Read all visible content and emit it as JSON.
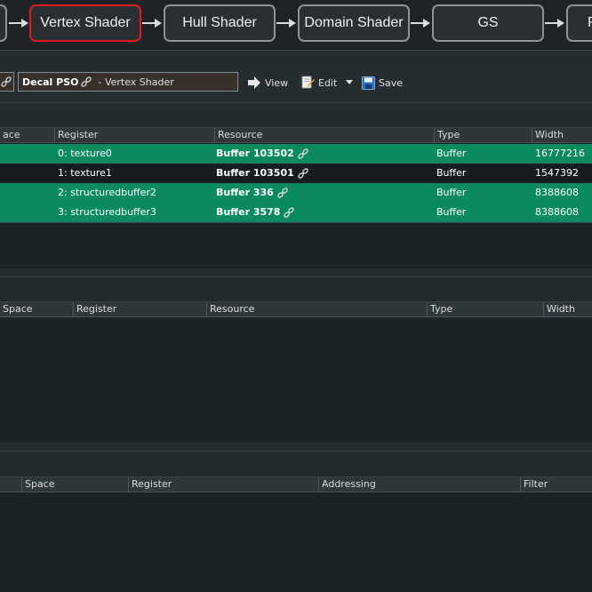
{
  "pipeline": {
    "stages": [
      {
        "label": ""
      },
      {
        "label": "Vertex Shader"
      },
      {
        "label": "Hull Shader"
      },
      {
        "label": "Domain Shader"
      },
      {
        "label": "GS"
      },
      {
        "label": "R"
      }
    ]
  },
  "toolbar": {
    "pso_name": "Decal PSO",
    "pso_suffix": "- Vertex Shader",
    "view_label": "View",
    "edit_label": "Edit",
    "save_label": "Save"
  },
  "resources": {
    "columns": [
      "ace",
      "Register",
      "Resource",
      "Type",
      "Width"
    ],
    "rows": [
      {
        "register": "0: texture0",
        "resource": "Buffer 103502",
        "type": "Buffer",
        "width": "16777216"
      },
      {
        "register": "1: texture1",
        "resource": "Buffer 103501",
        "type": "Buffer",
        "width": "1547392"
      },
      {
        "register": "2: structuredbuffer2",
        "resource": "Buffer 336",
        "type": "Buffer",
        "width": "8388608"
      },
      {
        "register": "3: structuredbuffer3",
        "resource": "Buffer 3578",
        "type": "Buffer",
        "width": "8388608"
      }
    ]
  },
  "uavs": {
    "columns": [
      "Space",
      "Register",
      "Resource",
      "Type",
      "Width"
    ]
  },
  "samplers": {
    "columns": [
      "",
      "Space",
      "Register",
      "Addressing",
      "Filter"
    ]
  },
  "colors": {
    "active_stage_border": "#e01b22",
    "row_green": "#0a8a5e",
    "row_dark": "#171c1f"
  }
}
